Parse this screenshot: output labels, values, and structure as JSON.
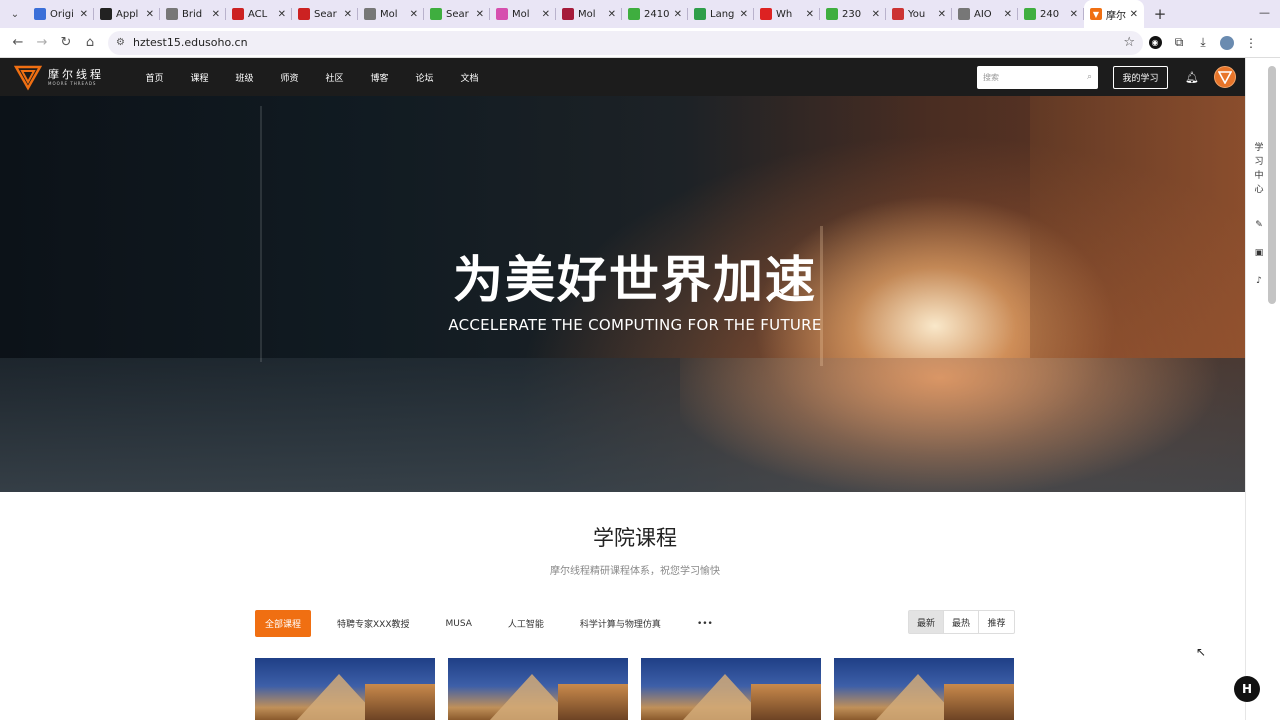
{
  "browser": {
    "tabs": [
      {
        "title": "Origi",
        "color": "#3b6fd8",
        "icon": "checkbox-icon"
      },
      {
        "title": "Appl",
        "color": "#222222",
        "icon": "dot-icon"
      },
      {
        "title": "Brid",
        "color": "#777777",
        "icon": "g-icon"
      },
      {
        "title": "ACL",
        "color": "#cc2222",
        "icon": "acl-icon"
      },
      {
        "title": "Sear",
        "color": "#cc2222",
        "icon": "acl-icon"
      },
      {
        "title": "Mol",
        "color": "#777777",
        "icon": "g-icon"
      },
      {
        "title": "Sear",
        "color": "#3fae3f",
        "icon": "hf-icon"
      },
      {
        "title": "Mol",
        "color": "#d64fae",
        "icon": "mol-icon"
      },
      {
        "title": "Mol",
        "color": "#a51b3a",
        "icon": "m-icon"
      },
      {
        "title": "2410",
        "color": "#3fae3f",
        "icon": "hf-icon"
      },
      {
        "title": "Lang",
        "color": "#2f9e4a",
        "icon": "circle-icon"
      },
      {
        "title": "Wh",
        "color": "#dd2222",
        "icon": "youtube-icon"
      },
      {
        "title": "230",
        "color": "#3fae3f",
        "icon": "hf-icon"
      },
      {
        "title": "You",
        "color": "#cc3333",
        "icon": "u-icon"
      },
      {
        "title": "AIO",
        "color": "#777777",
        "icon": "g-icon"
      },
      {
        "title": "240",
        "color": "#3fae3f",
        "icon": "hf-icon"
      }
    ],
    "active_tab": {
      "title": "摩尔",
      "color": "#f06f12"
    },
    "url": "hztest15.edusoho.cn"
  },
  "site": {
    "logo_cn": "摩尔线程",
    "logo_en": "MOORE THREADS",
    "brand_color": "#f06f12",
    "menu": [
      "首页",
      "课程",
      "班级",
      "师资",
      "社区",
      "博客",
      "论坛",
      "文档"
    ],
    "search_placeholder": "搜索",
    "my_learning": "我的学习"
  },
  "hero": {
    "title": "为美好世界加速",
    "subtitle": "ACCELERATE THE COMPUTING FOR THE FUTURE"
  },
  "courses": {
    "title": "学院课程",
    "subtitle": "摩尔线程精研课程体系，祝您学习愉快",
    "categories": [
      "全部课程",
      "特聘专家XXX教授",
      "MUSA",
      "人工智能",
      "科学计算与物理仿真",
      "•••"
    ],
    "sort": [
      "最新",
      "最热",
      "推荐"
    ]
  },
  "side_toolbar": {
    "labels": [
      "学",
      "习",
      "中",
      "心"
    ]
  }
}
